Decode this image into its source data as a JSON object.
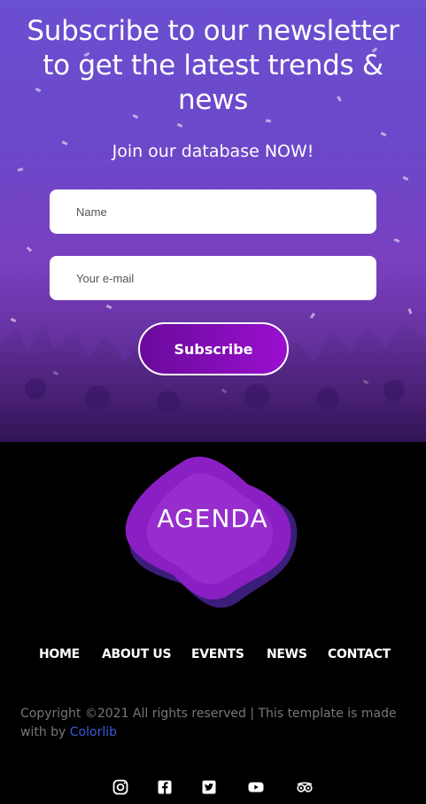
{
  "newsletter": {
    "title": "Subscribe to our newsletter to get the latest trends & news",
    "subtitle": "Join our database NOW!",
    "name_placeholder": "Name",
    "email_placeholder": "Your e-mail",
    "subscribe_label": "Subscribe"
  },
  "footer": {
    "logo_text": "AGENDA",
    "nav": [
      "HOME",
      "ABOUT US",
      "EVENTS",
      "NEWS",
      "CONTACT"
    ],
    "copyright_prefix": "Copyright ©2021 All rights reserved | This template is made with by ",
    "copyright_link": "Colorlib",
    "social": [
      "instagram-icon",
      "facebook-icon",
      "twitter-icon",
      "youtube-icon",
      "tripadvisor-icon"
    ]
  },
  "colors": {
    "accent": "#9a0fd0",
    "hero_overlay": "#6a4fd0",
    "link": "#3b5bdb"
  }
}
